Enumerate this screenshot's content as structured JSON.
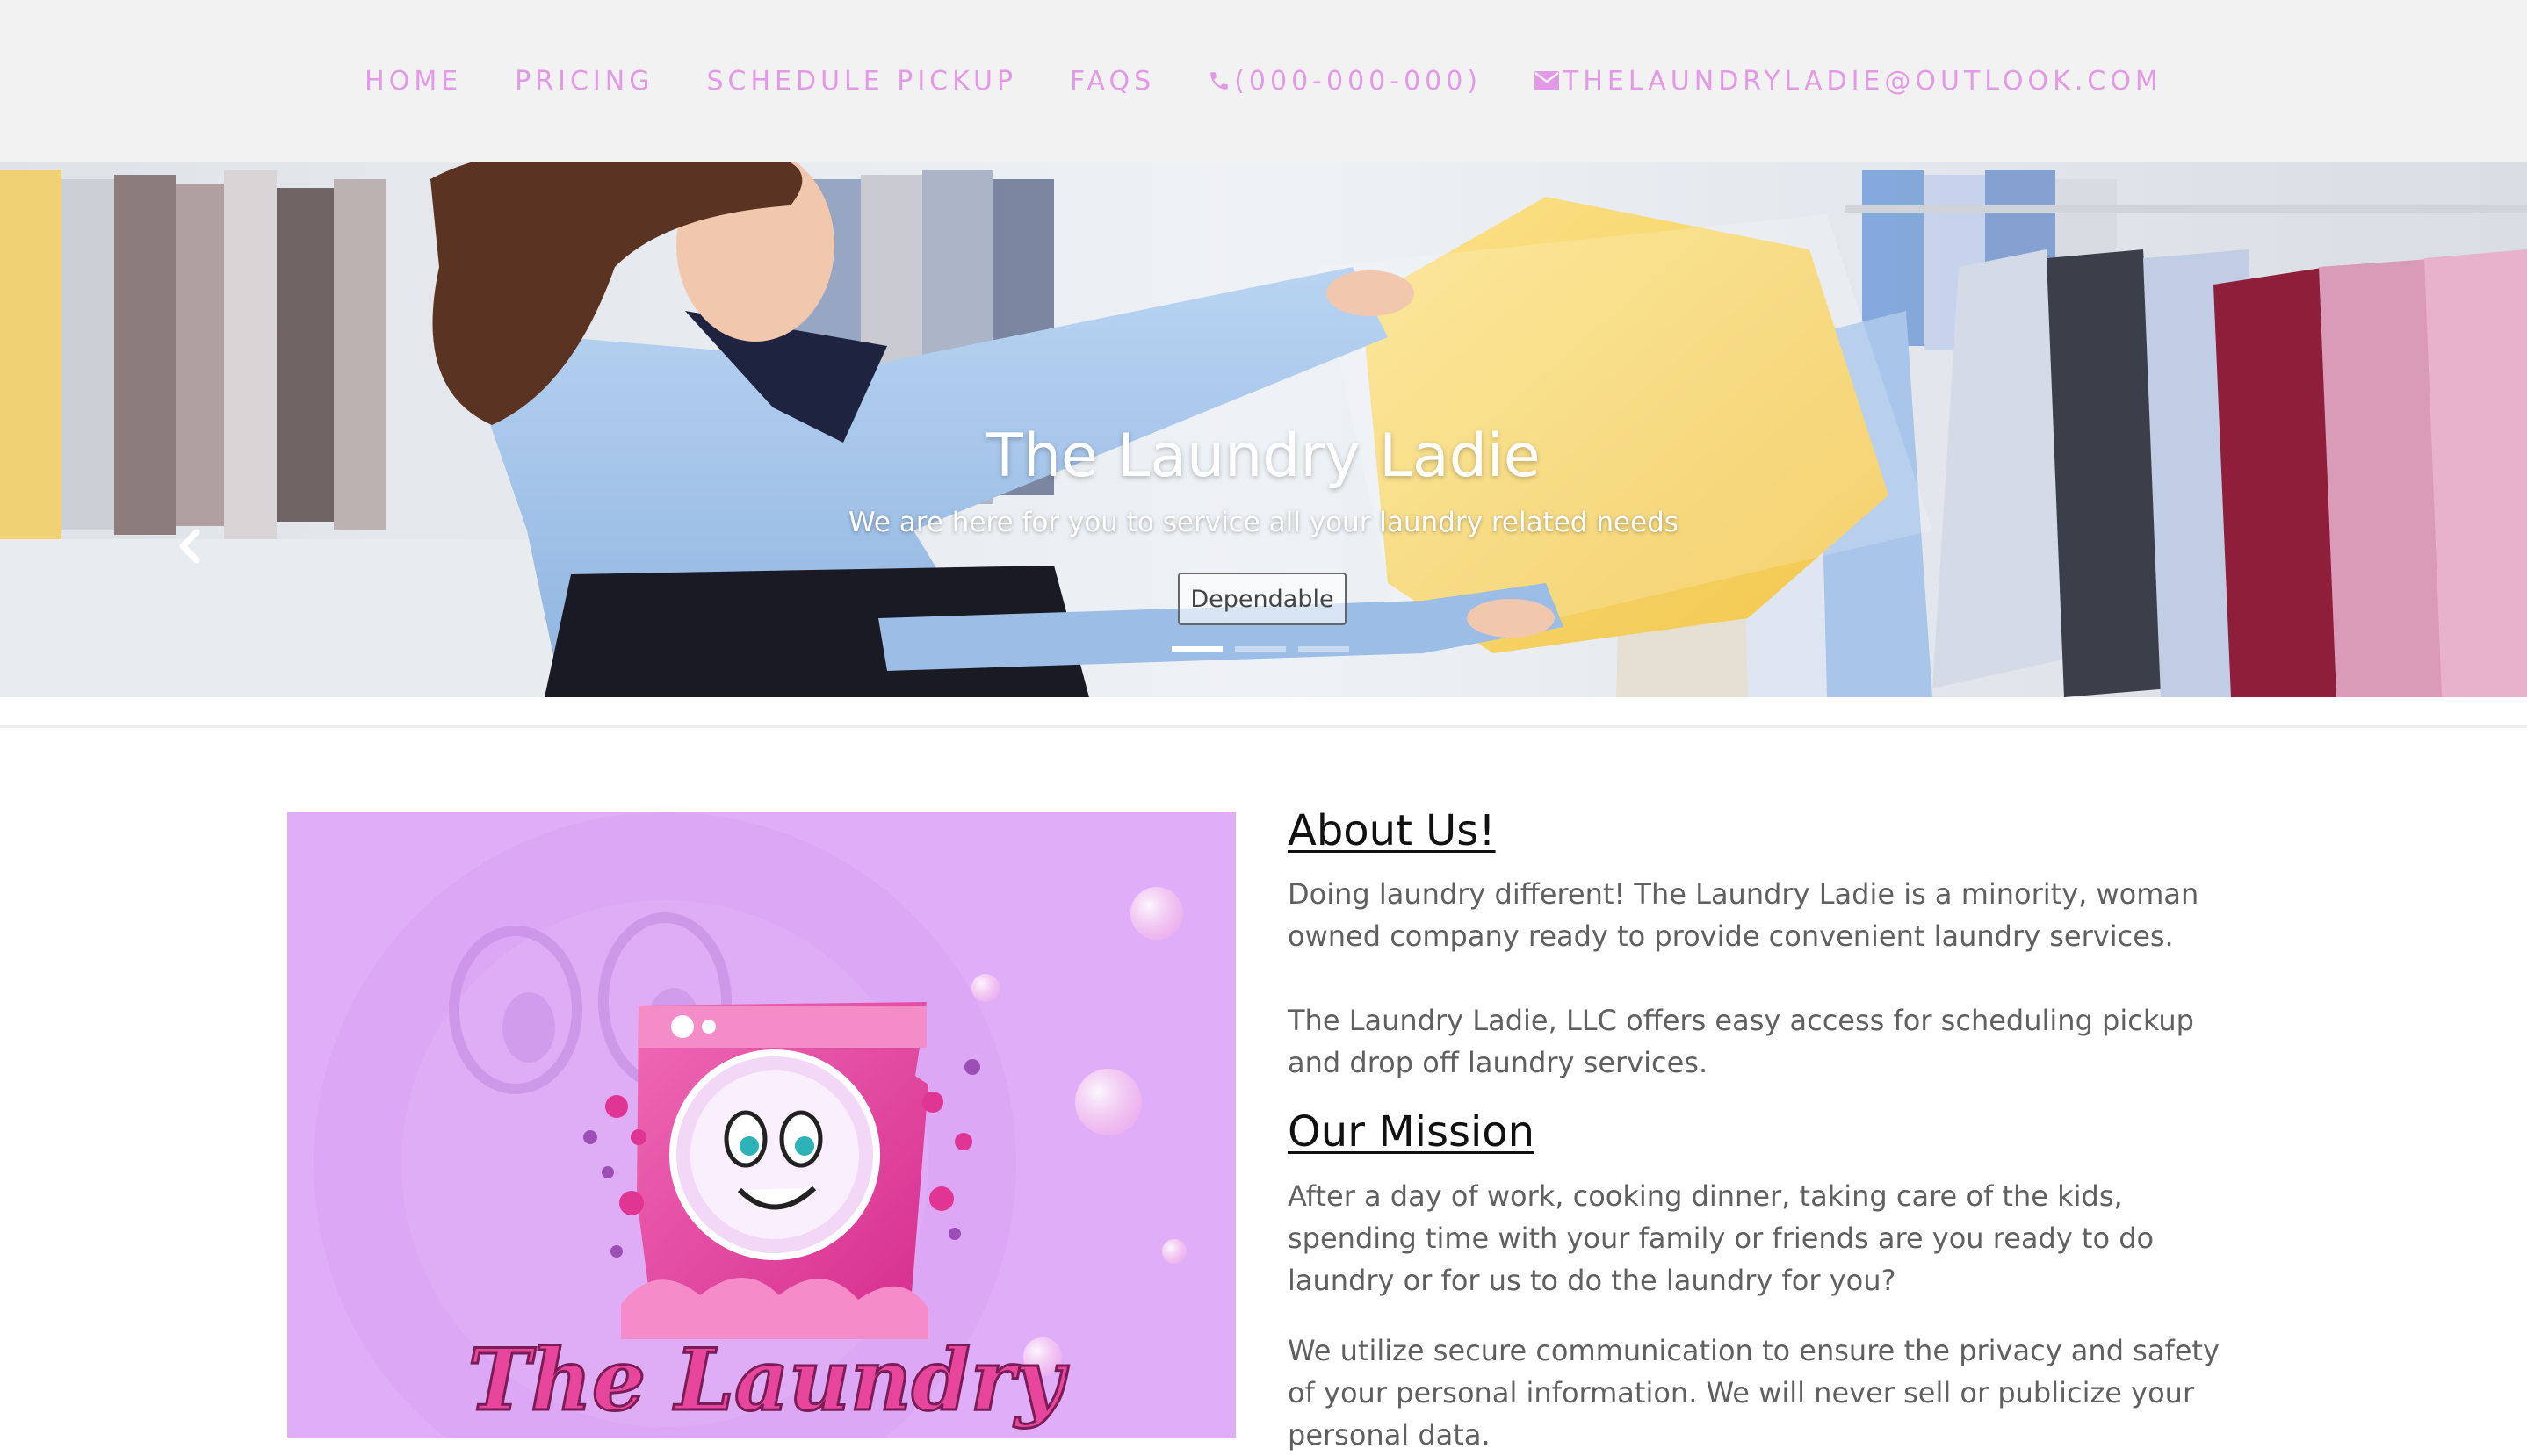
{
  "nav": {
    "items": [
      {
        "label": "HOME",
        "icon": null
      },
      {
        "label": "PRICING",
        "icon": null
      },
      {
        "label": "SCHEDULE PICKUP",
        "icon": null
      },
      {
        "label": "FAQS",
        "icon": null
      },
      {
        "label": "(000-000-000)",
        "icon": "phone-icon"
      },
      {
        "label": "THELAUNDRYLADIE@OUTLOOK.COM",
        "icon": "envelope-icon"
      }
    ]
  },
  "hero": {
    "title": "The Laundry Ladie",
    "subtitle": "We are here for you to service all your laundry related needs",
    "button_label": "Dependable",
    "slide_count": 3,
    "active_slide": 1
  },
  "logo": {
    "wordmark": "The Laundry Ladie"
  },
  "about": {
    "heading": "About Us!",
    "paragraph1": "Doing laundry different! The Laundry Ladie is a minority, woman owned company ready to provide convenient laundry services.",
    "paragraph2": "The Laundry Ladie, LLC offers easy access for scheduling pickup and drop off laundry services."
  },
  "mission": {
    "heading": "Our Mission",
    "paragraph1": "After a day of work, cooking dinner, taking care of the kids, spending time with your family or friends are you ready to do laundry or for us to do the laundry for you?",
    "paragraph2": "We utilize secure communication to ensure the privacy and safety of your personal information. We will never sell or publicize your personal data."
  },
  "colors": {
    "nav_text": "#e29ae6",
    "nav_bg": "#f2f2f2",
    "logo_bg": "#e0aef8",
    "brand_pink": "#e8459d"
  }
}
